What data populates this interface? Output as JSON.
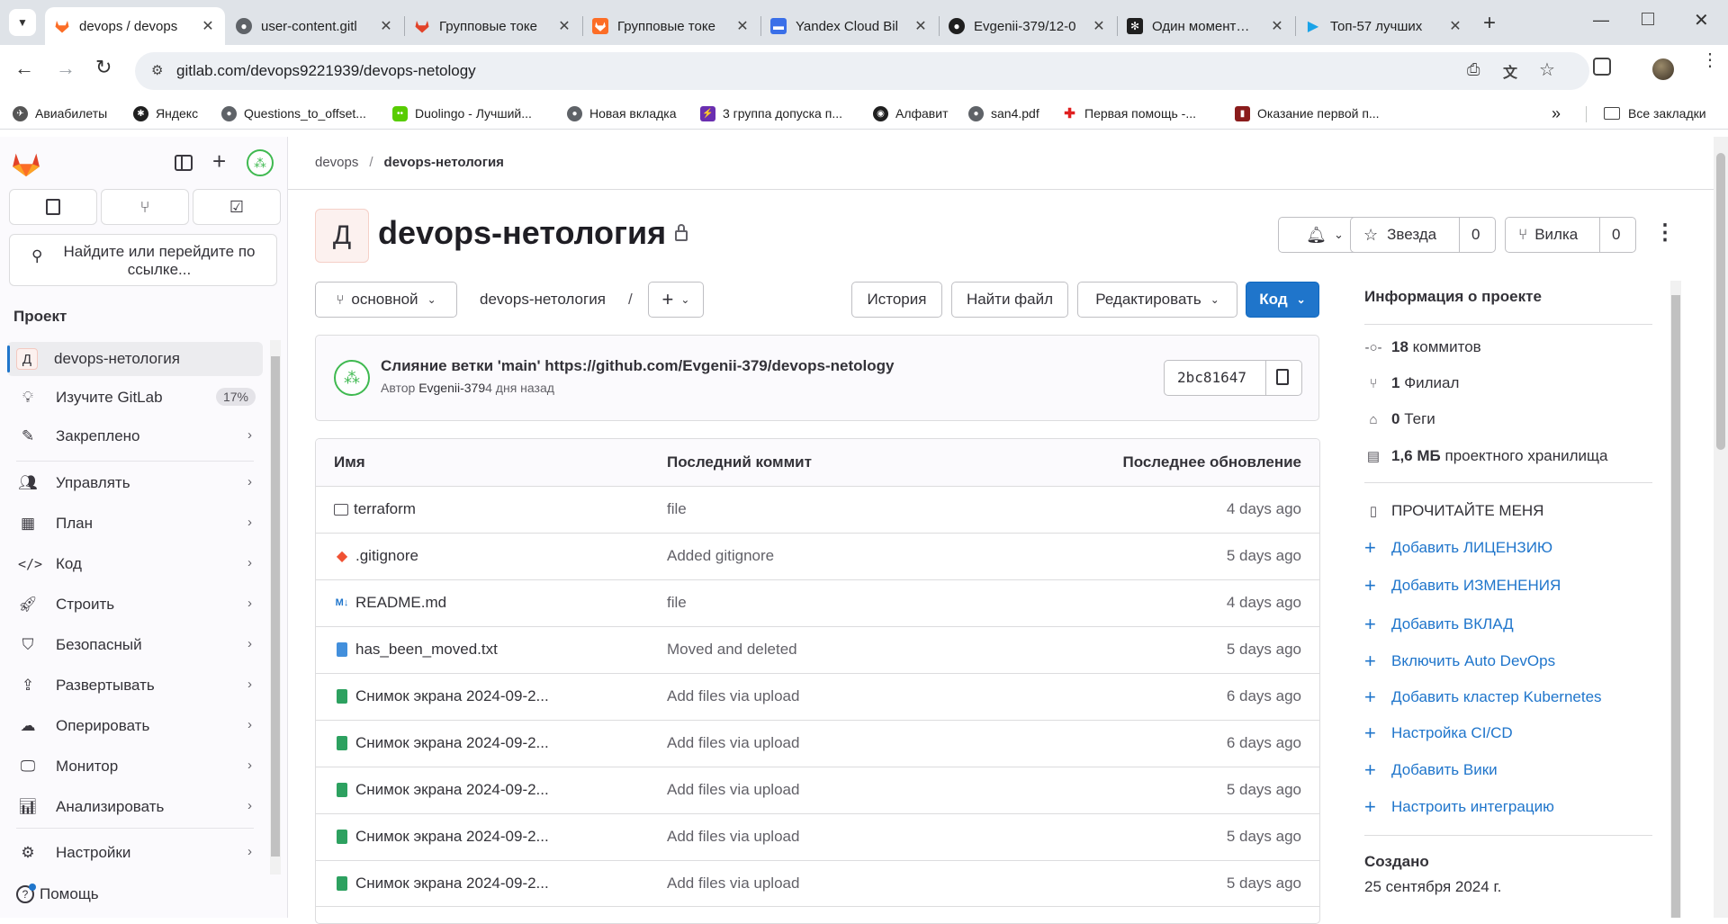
{
  "browser": {
    "tabs": [
      {
        "title": "devops / devops",
        "active": true,
        "favicon": "gitlab-icon"
      },
      {
        "title": "user-content.gitl",
        "active": false,
        "favicon": "globe-icon"
      },
      {
        "title": "Групповые токе",
        "active": false,
        "favicon": "gitlab-icon"
      },
      {
        "title": "Групповые токе",
        "active": false,
        "favicon": "gitlab-orange-icon"
      },
      {
        "title": "Yandex Cloud Bil",
        "active": false,
        "favicon": "yandex-cloud-icon"
      },
      {
        "title": "Evgenii-379/12-0",
        "active": false,
        "favicon": "github-icon"
      },
      {
        "title": "Один момент…",
        "active": false,
        "favicon": "openai-icon"
      },
      {
        "title": "Топ-57 лучших",
        "active": false,
        "favicon": "play-icon"
      }
    ],
    "url": "gitlab.com/devops9221939/devops-netology",
    "bookmarks": [
      {
        "label": "Авиабилеты",
        "icon": "plane-icon"
      },
      {
        "label": "Яндекс",
        "icon": "yandex-icon"
      },
      {
        "label": "Questions_to_offset...",
        "icon": "globe-icon"
      },
      {
        "label": "Duolingo - Лучший...",
        "icon": "duolingo-icon"
      },
      {
        "label": "Новая вкладка",
        "icon": "globe-icon"
      },
      {
        "label": "3 группа допуска п...",
        "icon": "bolt-icon"
      },
      {
        "label": "Алфавит",
        "icon": "eye-icon"
      },
      {
        "label": "san4.pdf",
        "icon": "globe-icon"
      },
      {
        "label": "Первая помощь -...",
        "icon": "cross-icon"
      },
      {
        "label": "Оказание первой п...",
        "icon": "book-icon"
      }
    ],
    "all_bookmarks": "Все закладки"
  },
  "sidebar": {
    "search_placeholder": "Найдите или перейдите по ссылке...",
    "section": "Проект",
    "project": {
      "letter": "Д",
      "name": "devops-нетология"
    },
    "learn": {
      "label": "Изучите GitLab",
      "badge": "17%"
    },
    "items": [
      {
        "label": "Закреплено",
        "icon": "pin-icon"
      },
      {
        "label": "Управлять",
        "icon": "users-icon"
      },
      {
        "label": "План",
        "icon": "calendar-icon"
      },
      {
        "label": "Код",
        "icon": "code-icon"
      },
      {
        "label": "Строить",
        "icon": "rocket-icon"
      },
      {
        "label": "Безопасный",
        "icon": "shield-icon"
      },
      {
        "label": "Развертывать",
        "icon": "deploy-icon"
      },
      {
        "label": "Оперировать",
        "icon": "cloud-icon"
      },
      {
        "label": "Монитор",
        "icon": "monitor-icon"
      },
      {
        "label": "Анализировать",
        "icon": "chart-icon"
      },
      {
        "label": "Настройки",
        "icon": "settings-icon"
      }
    ],
    "help": "Помощь"
  },
  "breadcrumb": {
    "group": "devops",
    "project": "devops-нетология"
  },
  "project": {
    "avatar_letter": "Д",
    "title": "devops-нетология",
    "star_label": "Звезда",
    "star_count": "0",
    "fork_label": "Вилка",
    "fork_count": "0"
  },
  "repo_bar": {
    "branch": "основной",
    "path": "devops-нетология",
    "path_sep": "/",
    "history": "История",
    "find_file": "Найти файл",
    "edit": "Редактировать",
    "code": "Код"
  },
  "last_commit": {
    "message": "Слияние ветки 'main' https://github.com/Evgenii-379/devops-netology",
    "author_prefix": "Автор",
    "author": "Evgenii-379",
    "time": "4 дня назад",
    "sha": "2bc81647"
  },
  "file_table": {
    "headers": [
      "Имя",
      "Последний коммит",
      "Последнее обновление"
    ],
    "rows": [
      {
        "name": "terraform",
        "icon": "folder-icon",
        "commit": "file",
        "updated": "4 days ago"
      },
      {
        "name": ".gitignore",
        "icon": "git-icon",
        "commit": "Added gitignore",
        "updated": "5 days ago"
      },
      {
        "name": "README.md",
        "icon": "markdown-icon",
        "commit": "file",
        "updated": "4 days ago"
      },
      {
        "name": "has_been_moved.txt",
        "icon": "text-file-icon",
        "commit": "Moved and deleted",
        "updated": "5 days ago"
      },
      {
        "name": "Снимок экрана 2024-09-2...",
        "icon": "image-file-icon",
        "commit": "Add files via upload",
        "updated": "6 days ago"
      },
      {
        "name": "Снимок экрана 2024-09-2...",
        "icon": "image-file-icon",
        "commit": "Add files via upload",
        "updated": "6 days ago"
      },
      {
        "name": "Снимок экрана 2024-09-2...",
        "icon": "image-file-icon",
        "commit": "Add files via upload",
        "updated": "5 days ago"
      },
      {
        "name": "Снимок экрана 2024-09-2...",
        "icon": "image-file-icon",
        "commit": "Add files via upload",
        "updated": "5 days ago"
      },
      {
        "name": "Снимок экрана 2024-09-2...",
        "icon": "image-file-icon",
        "commit": "Add files via upload",
        "updated": "5 days ago"
      }
    ]
  },
  "project_info": {
    "heading": "Информация о проекте",
    "stats": [
      {
        "bold": "18",
        "text": "коммитов",
        "icon": "commit-icon"
      },
      {
        "bold": "1",
        "text": "Филиал",
        "icon": "branch-icon"
      },
      {
        "bold": "0",
        "text": "Теги",
        "icon": "tag-icon"
      },
      {
        "bold": "1,6 МБ",
        "text": "проектного хранилища",
        "icon": "storage-icon"
      }
    ],
    "readme": "ПРОЧИТАЙТЕ МЕНЯ",
    "links": [
      "Добавить ЛИЦЕНЗИЮ",
      "Добавить ИЗМЕНЕНИЯ",
      "Добавить ВКЛАД",
      "Включить Auto DevOps",
      "Добавить кластер Kubernetes",
      "Настройка CI/CD",
      "Добавить Вики",
      "Настроить интеграцию"
    ],
    "created_label": "Создано",
    "created_date": "25 сентября 2024 г."
  },
  "colors": {
    "accent": "#1f75cb",
    "gitlab_orange": "#fc6d26",
    "avatar_bg": "#fcf1ef"
  }
}
